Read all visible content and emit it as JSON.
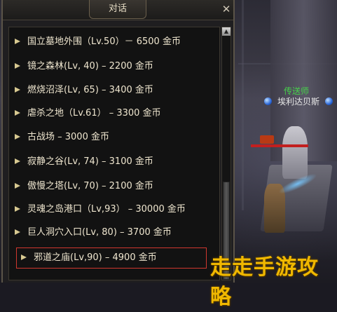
{
  "dialog": {
    "title": "对话",
    "close_label": "✕",
    "scroll_up_label": "▲",
    "items": [
      {
        "label": "国立墓地外围（Lv.50）－ 6500 金币"
      },
      {
        "label": "镜之森林(Lv, 40) – 2200 金币"
      },
      {
        "label": "燃烧沼泽(Lv, 65) – 3400 金币"
      },
      {
        "label": "虐杀之地（Lv.61） – 3300 金币"
      },
      {
        "label": "古战场 – 3000 金币"
      },
      {
        "label": "寂静之谷(Lv, 74) – 3100 金币"
      },
      {
        "label": "傲慢之塔(Lv, 70) – 2100 金币"
      },
      {
        "label": "灵魂之岛港口（Lv,93） – 30000 金币"
      },
      {
        "label": "巨人洞穴入口(Lv, 80) – 3700 金币"
      },
      {
        "label": "邪道之庙(Lv,90) – 4900 金币",
        "selected": true
      }
    ]
  },
  "scene": {
    "npc_title": "传送师",
    "npc_name": "埃利达贝斯"
  },
  "watermark": "走走手游攻略",
  "colors": {
    "npc_title": "#46d14a",
    "selection_border": "#d0382f",
    "watermark": "#f0b800"
  }
}
